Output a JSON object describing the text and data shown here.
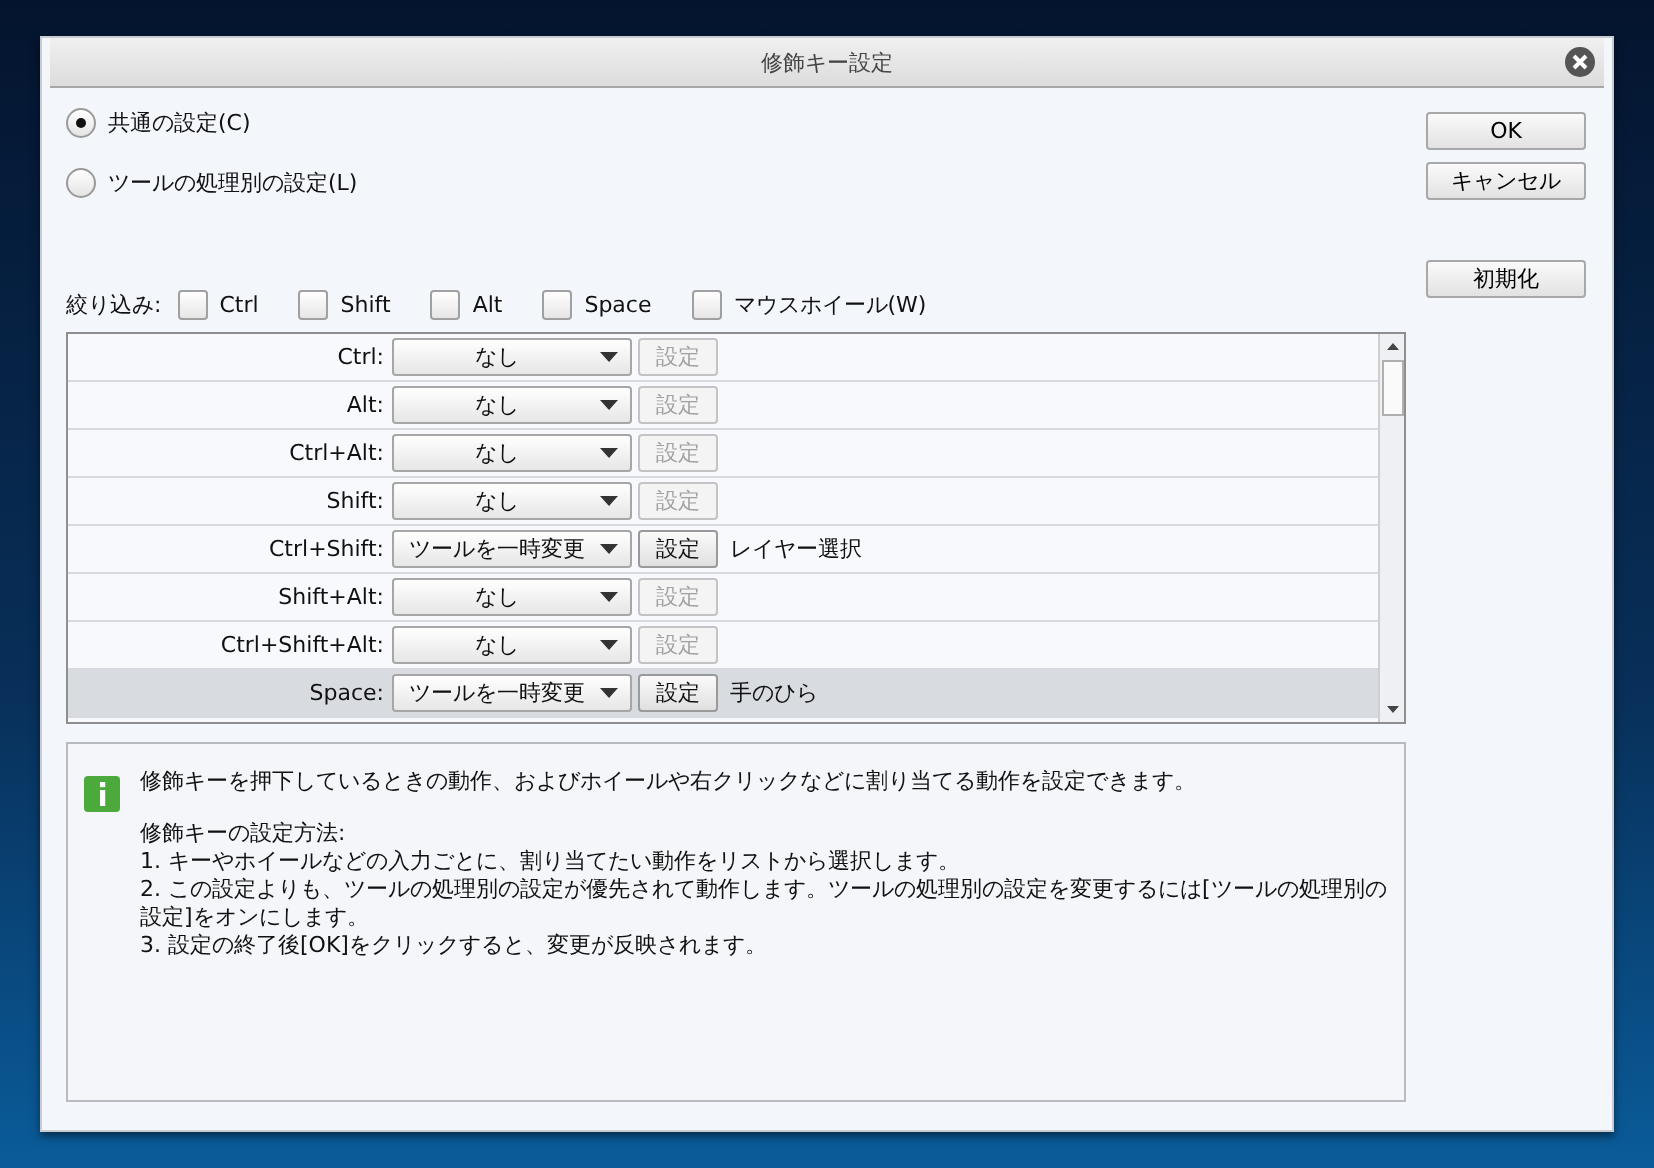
{
  "window": {
    "title": "修飾キー設定"
  },
  "modes": [
    {
      "label": "共通の設定(C)",
      "selected": true
    },
    {
      "label": "ツールの処理別の設定(L)",
      "selected": false
    }
  ],
  "buttons": [
    {
      "label": "OK"
    },
    {
      "label": "キャンセル"
    }
  ],
  "reset_button": {
    "label": "初期化"
  },
  "filter": {
    "label": "絞り込み:",
    "options": [
      {
        "label": "Ctrl",
        "checked": false
      },
      {
        "label": "Shift",
        "checked": false
      },
      {
        "label": "Alt",
        "checked": false
      },
      {
        "label": "Space",
        "checked": false
      },
      {
        "label": "マウスホイール(W)",
        "checked": false
      }
    ]
  },
  "rows": [
    {
      "key": "Ctrl:",
      "action": "なし",
      "button": "設定",
      "enabled": false,
      "selected": false
    },
    {
      "key": "Alt:",
      "action": "なし",
      "button": "設定",
      "enabled": false,
      "selected": false
    },
    {
      "key": "Ctrl+Alt:",
      "action": "なし",
      "button": "設定",
      "enabled": false,
      "selected": false
    },
    {
      "key": "Shift:",
      "action": "なし",
      "button": "設定",
      "enabled": false,
      "selected": false
    },
    {
      "key": "Ctrl+Shift:",
      "action": "ツールを一時変更",
      "button": "設定",
      "enabled": true,
      "target": "レイヤー選択",
      "selected": false
    },
    {
      "key": "Shift+Alt:",
      "action": "なし",
      "button": "設定",
      "enabled": false,
      "selected": false
    },
    {
      "key": "Ctrl+Shift+Alt:",
      "action": "なし",
      "button": "設定",
      "enabled": false,
      "selected": false
    },
    {
      "key": "Space:",
      "action": "ツールを一時変更",
      "button": "設定",
      "enabled": true,
      "target": "手のひら",
      "selected": true
    }
  ],
  "info": {
    "paragraphs": [
      [
        "修飾キーを押下しているときの動作、およびホイールや右クリックなどに割り当てる動作を設定できます。"
      ],
      [
        "修飾キーの設定方法:",
        "1. キーやホイールなどの入力ごとに、割り当てたい動作をリストから選択します。",
        "2. この設定よりも、ツールの処理別の設定が優先されて動作します。ツールの処理別の設定を変更するには[ツールの処理別の設定]をオンにします。",
        "3. 設定の終了後[OK]をクリックすると、変更が反映されます。"
      ]
    ]
  }
}
